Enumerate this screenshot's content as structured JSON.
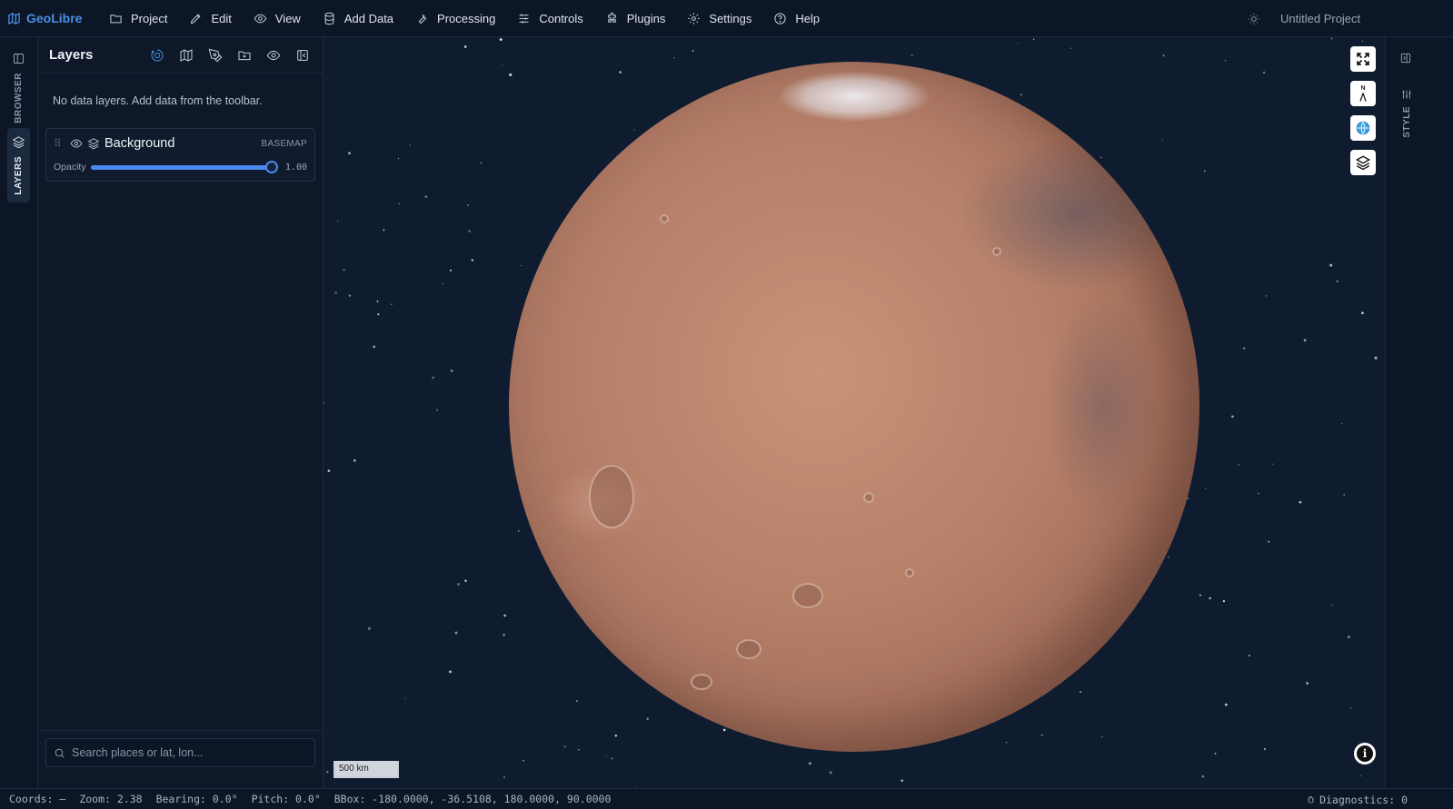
{
  "app": {
    "brand": "GeoLibre",
    "project_title": "Untitled Project"
  },
  "menu": [
    {
      "label": "Project",
      "icon": "folder-icon"
    },
    {
      "label": "Edit",
      "icon": "pencil-icon"
    },
    {
      "label": "View",
      "icon": "eye-icon"
    },
    {
      "label": "Add Data",
      "icon": "database-icon"
    },
    {
      "label": "Processing",
      "icon": "wrench-icon"
    },
    {
      "label": "Controls",
      "icon": "sliders-icon"
    },
    {
      "label": "Plugins",
      "icon": "puzzle-icon"
    },
    {
      "label": "Settings",
      "icon": "gear-icon"
    },
    {
      "label": "Help",
      "icon": "help-circle-icon"
    }
  ],
  "left_rail": {
    "browser_label": "BROWSER",
    "layers_label": "LAYERS",
    "active": "LAYERS"
  },
  "layers_panel": {
    "title": "Layers",
    "empty_message": "No data layers. Add data from the toolbar.",
    "layers": [
      {
        "name": "Background",
        "type": "BASEMAP",
        "visible": true,
        "opacity_label": "Opacity",
        "opacity_value": "1.00",
        "opacity": 1.0
      }
    ],
    "search_placeholder": "Search places or lat, lon..."
  },
  "map": {
    "scale_label": "500 km",
    "compass_label": "N",
    "colors": {
      "space": "#0f1c30",
      "planet": "#b7816a",
      "accent": "#4a90e2"
    }
  },
  "right_rail": {
    "style_label": "STYLE"
  },
  "status": {
    "coords": "Coords: —",
    "zoom": "Zoom: 2.38",
    "bearing": "Bearing: 0.0°",
    "pitch": "Pitch: 0.0°",
    "bbox": "BBox: -180.0000, -36.5108, 180.0000, 90.0000",
    "diagnostics": "Diagnostics: 0"
  }
}
